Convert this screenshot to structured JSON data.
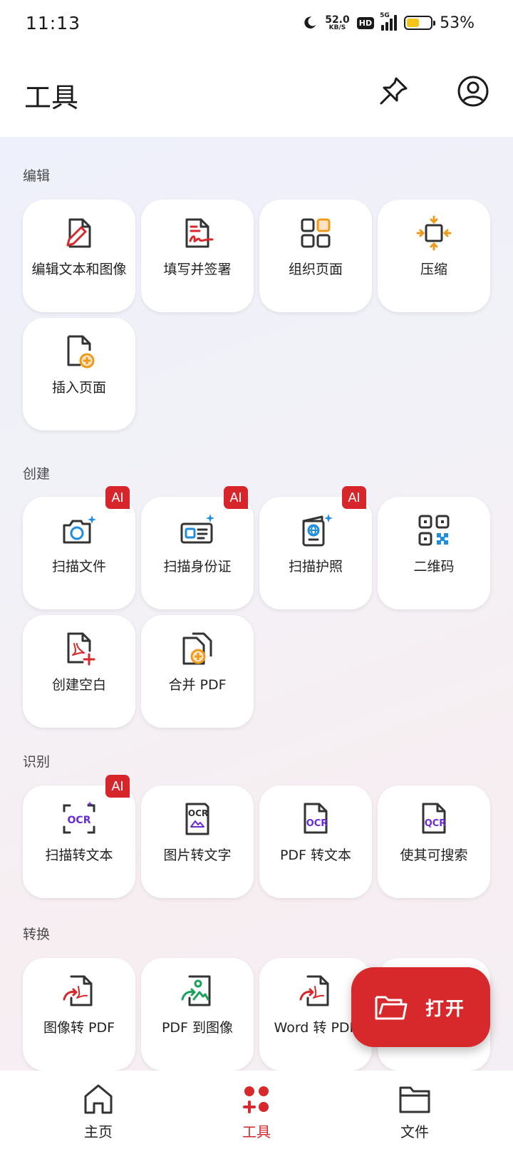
{
  "status_bar": {
    "time": "11:13",
    "net_speed_value": "52.0",
    "net_speed_unit": "KB/S",
    "hd": "HD",
    "network": "5G",
    "battery_percent": "53%",
    "battery_level": 0.53
  },
  "header": {
    "title": "工具",
    "pin_icon": "pin-icon",
    "account_icon": "account-icon"
  },
  "ai_badge_text": "AI",
  "sections": {
    "edit": {
      "title": "编辑",
      "items": [
        {
          "label": "编辑文本和图像",
          "icon": "edit-document-icon"
        },
        {
          "label": "填写并签署",
          "icon": "sign-document-icon"
        },
        {
          "label": "组织页面",
          "icon": "organize-pages-icon"
        },
        {
          "label": "压缩",
          "icon": "compress-icon"
        },
        {
          "label": "插入页面",
          "icon": "insert-page-icon"
        }
      ]
    },
    "create": {
      "title": "创建",
      "items": [
        {
          "label": "扫描文件",
          "icon": "camera-scan-icon",
          "ai": true
        },
        {
          "label": "扫描身份证",
          "icon": "id-card-scan-icon",
          "ai": true
        },
        {
          "label": "扫描护照",
          "icon": "passport-scan-icon",
          "ai": true
        },
        {
          "label": "二维码",
          "icon": "qr-code-icon"
        },
        {
          "label": "创建空白",
          "icon": "create-blank-pdf-icon"
        },
        {
          "label": "合并 PDF",
          "icon": "merge-pdf-icon"
        }
      ]
    },
    "recognize": {
      "title": "识别",
      "items": [
        {
          "label": "扫描转文本",
          "icon": "scan-ocr-icon",
          "ai": true
        },
        {
          "label": "图片转文字",
          "icon": "image-ocr-icon"
        },
        {
          "label": "PDF 转文本",
          "icon": "pdf-ocr-icon"
        },
        {
          "label": "使其可搜索",
          "icon": "searchable-qcr-icon"
        }
      ]
    },
    "convert": {
      "title": "转换",
      "items": [
        {
          "label": "图像转 PDF",
          "icon": "image-to-pdf-icon"
        },
        {
          "label": "PDF 到图像",
          "icon": "pdf-to-image-icon"
        },
        {
          "label": "Word 转 PDF",
          "icon": "word-to-pdf-icon"
        }
      ]
    }
  },
  "fab": {
    "label": "打开",
    "icon": "open-folder-icon"
  },
  "bottom_nav": [
    {
      "label": "主页",
      "icon": "home-icon"
    },
    {
      "label": "工具",
      "icon": "tools-icon",
      "active": true
    },
    {
      "label": "文件",
      "icon": "folder-icon"
    }
  ],
  "colors": {
    "accent_red": "#d7282c",
    "ai_badge": "#d7262b",
    "orange": "#f09a1a",
    "blue": "#1f8de0",
    "purple": "#6a2bd9"
  }
}
